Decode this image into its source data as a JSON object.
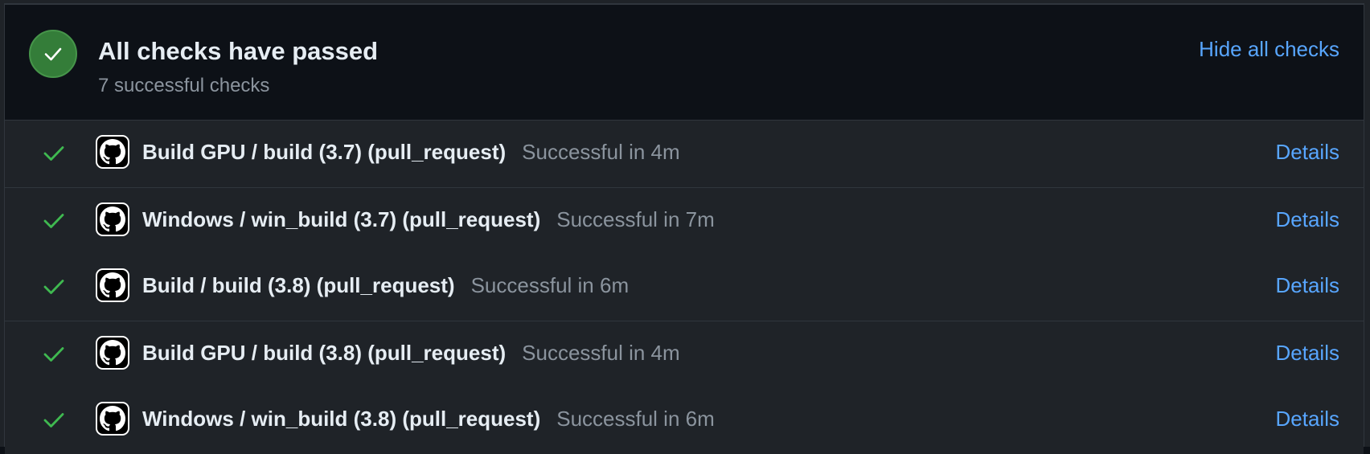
{
  "header": {
    "title": "All checks have passed",
    "subtitle": "7 successful checks",
    "hide_link": "Hide all checks"
  },
  "checks": [
    {
      "name": "Build GPU / build (3.7) (pull_request)",
      "status": "Successful in 4m",
      "details": "Details"
    },
    {
      "name": "Windows / win_build (3.7) (pull_request)",
      "status": "Successful in 7m",
      "details": "Details"
    },
    {
      "name": "Build / build (3.8) (pull_request)",
      "status": "Successful in 6m",
      "details": "Details"
    },
    {
      "name": "Build GPU / build (3.8) (pull_request)",
      "status": "Successful in 4m",
      "details": "Details"
    },
    {
      "name": "Windows / win_build (3.8) (pull_request)",
      "status": "Successful in 6m",
      "details": "Details"
    }
  ],
  "colors": {
    "success": "#3fb950",
    "link": "#58a6ff",
    "status_circle": "#347d39"
  },
  "icons": {
    "status": "check-icon",
    "app": "github-icon"
  }
}
